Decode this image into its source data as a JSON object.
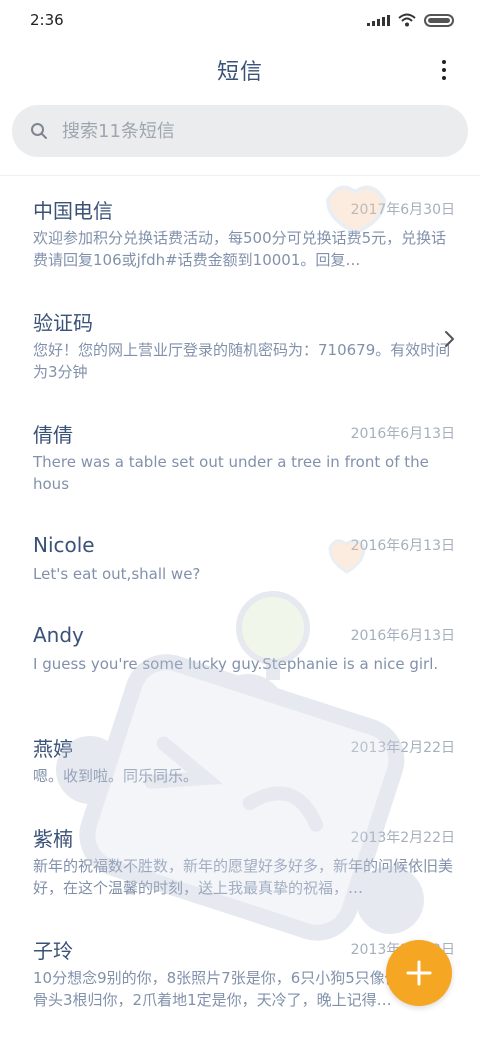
{
  "status_bar": {
    "time": "2:36"
  },
  "header": {
    "title": "短信"
  },
  "search": {
    "placeholder": "搜索11条短信"
  },
  "conversations": [
    {
      "sender": "中国电信",
      "date": "2017年6月30日",
      "preview": "欢迎参加积分兑换话费活动，每500分可兑换话费5元，兑换话费请回复106或jfdh#话费金额到10001。回复…"
    },
    {
      "sender": "验证码",
      "date": "",
      "preview": "您好！您的网上营业厅登录的随机密码为：710679。有效时间为3分钟"
    },
    {
      "sender": "倩倩",
      "date": "2016年6月13日",
      "preview": "There was a table set out under a tree in front of the hous"
    },
    {
      "sender": "Nicole",
      "date": "2016年6月13日",
      "preview": "Let's eat out,shall we?"
    },
    {
      "sender": "Andy",
      "date": "2016年6月13日",
      "preview": "I guess you're some lucky guy.Stephanie is a nice girl."
    },
    {
      "sender": "燕婷",
      "date": "2013年2月22日",
      "preview": "嗯。收到啦。同乐同乐。"
    },
    {
      "sender": "紫楠",
      "date": "2013年2月22日",
      "preview": "新年的祝福数不胜数，新年的愿望好多好多，新年的问候依旧美好，在这个温馨的时刻，送上我最真挚的祝福，…"
    },
    {
      "sender": "子玲",
      "date": "2013年2月22日",
      "preview": "10分想念9别的你，8张照片7张是你，6只小狗5只像你，4根骨头3根归你，2爪着地1定是你，天冷了，晚上记得…"
    }
  ],
  "icons": {
    "search": "search-icon",
    "more": "more-vertical-icon",
    "chevron": "chevron-right-icon",
    "compose": "plus-icon"
  },
  "colors": {
    "accent": "#f5a623",
    "title": "#3b5278",
    "preview": "#8291ab",
    "date": "#a5afbd",
    "search_bg": "#ebeced"
  }
}
